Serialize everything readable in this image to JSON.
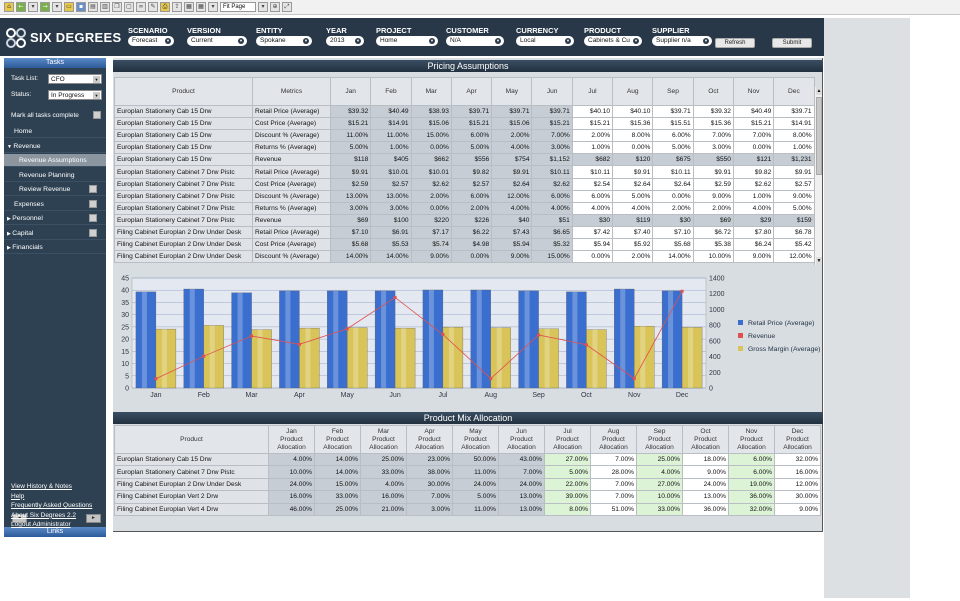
{
  "toolbar": {
    "page_fit": "Fit Page"
  },
  "brand": "SIX DEGREES",
  "header": {
    "fields": [
      {
        "label": "SCENARIO",
        "value": "Forecast"
      },
      {
        "label": "VERSION",
        "value": "Current"
      },
      {
        "label": "ENTITY",
        "value": "Spokane"
      },
      {
        "label": "YEAR",
        "value": "2013"
      },
      {
        "label": "PROJECT",
        "value": "Home"
      },
      {
        "label": "CUSTOMER",
        "value": "N/A"
      },
      {
        "label": "CURRENCY",
        "value": "Local"
      },
      {
        "label": "PRODUCT",
        "value": "Cabinets & Cu"
      },
      {
        "label": "SUPPLIER",
        "value": "Supplier n/a"
      }
    ],
    "refresh_label": "Refresh",
    "submit_label": "Submit"
  },
  "sidebar": {
    "tasks_title": "Tasks",
    "task_list_label": "Task List:",
    "task_list_value": "CFO",
    "status_label": "Status:",
    "status_value": "In Progress",
    "mark_complete_label": "Mark all tasks complete",
    "nav": [
      {
        "label": "Home",
        "indent": 0,
        "expander": "",
        "check": false
      },
      {
        "label": "Revenue",
        "indent": 0,
        "expander": "▼",
        "check": false
      },
      {
        "label": "Revenue Assumptions",
        "indent": 2,
        "expander": "",
        "check": false,
        "active": true
      },
      {
        "label": "Revenue Planning",
        "indent": 2,
        "expander": "",
        "check": false
      },
      {
        "label": "Review Revenue",
        "indent": 2,
        "expander": "",
        "check": true
      },
      {
        "label": "Expenses",
        "indent": 0,
        "expander": "",
        "check": true
      },
      {
        "label": "Personnel",
        "indent": 0,
        "expander": "▶",
        "check": true
      },
      {
        "label": "Capital",
        "indent": 0,
        "expander": "▶",
        "check": true
      },
      {
        "label": "Financials",
        "indent": 0,
        "expander": "▶",
        "check": false
      }
    ],
    "links_title": "Links",
    "links": [
      "View History & Notes",
      "Help",
      "Frequently Asked Questions",
      "About Six Degrees 2.2",
      "Logout Administrator"
    ]
  },
  "pricing": {
    "title": "Pricing Assumptions",
    "headers": [
      "Product",
      "Metrics",
      "Jan",
      "Feb",
      "Mar",
      "Apr",
      "May",
      "Jun",
      "Jul",
      "Aug",
      "Sep",
      "Oct",
      "Nov",
      "Dec"
    ],
    "rows": [
      {
        "product": "Europlan Stationery Cab 15 Drw",
        "metric": "Retail Price (Average)",
        "values": [
          "$39.32",
          "$40.49",
          "$38.93",
          "$39.71",
          "$39.71",
          "$39.71",
          "$40.10",
          "$40.10",
          "$39.71",
          "$39.32",
          "$40.49",
          "$39.71"
        ],
        "band": false
      },
      {
        "product": "Europlan Stationery Cab 15 Drw",
        "metric": "Cost Price (Average)",
        "values": [
          "$15.21",
          "$14.91",
          "$15.06",
          "$15.21",
          "$15.06",
          "$15.21",
          "$15.21",
          "$15.36",
          "$15.51",
          "$15.36",
          "$15.21",
          "$14.91"
        ],
        "band": false
      },
      {
        "product": "Europlan Stationery Cab 15 Drw",
        "metric": "Discount % (Average)",
        "values": [
          "11.00%",
          "11.00%",
          "15.00%",
          "6.00%",
          "2.00%",
          "7.00%",
          "2.00%",
          "8.00%",
          "6.00%",
          "7.00%",
          "7.00%",
          "8.00%"
        ],
        "band": false
      },
      {
        "product": "Europlan Stationery Cab 15 Drw",
        "metric": "Returns % (Average)",
        "values": [
          "5.00%",
          "1.00%",
          "0.00%",
          "5.00%",
          "4.00%",
          "3.00%",
          "1.00%",
          "0.00%",
          "5.00%",
          "3.00%",
          "0.00%",
          "1.00%"
        ],
        "band": false
      },
      {
        "product": "Europlan Stationery Cab 15 Drw",
        "metric": "Revenue",
        "values": [
          "$118",
          "$405",
          "$662",
          "$556",
          "$754",
          "$1,152",
          "$682",
          "$120",
          "$675",
          "$550",
          "$121",
          "$1,231"
        ],
        "band": true
      },
      {
        "product": "Europlan Stationery Cabinet 7 Drw Pistc",
        "metric": "Retail Price (Average)",
        "values": [
          "$9.91",
          "$10.01",
          "$10.01",
          "$9.82",
          "$9.91",
          "$10.11",
          "$10.11",
          "$9.91",
          "$10.11",
          "$9.91",
          "$9.82",
          "$9.91"
        ],
        "band": false
      },
      {
        "product": "Europlan Stationery Cabinet 7 Drw Pistc",
        "metric": "Cost Price (Average)",
        "values": [
          "$2.59",
          "$2.57",
          "$2.62",
          "$2.57",
          "$2.64",
          "$2.62",
          "$2.54",
          "$2.64",
          "$2.64",
          "$2.59",
          "$2.62",
          "$2.57"
        ],
        "band": false
      },
      {
        "product": "Europlan Stationery Cabinet 7 Drw Pistc",
        "metric": "Discount % (Average)",
        "values": [
          "13.00%",
          "13.00%",
          "2.00%",
          "6.00%",
          "12.00%",
          "6.00%",
          "6.00%",
          "5.00%",
          "0.00%",
          "9.00%",
          "1.00%",
          "9.00%"
        ],
        "band": false
      },
      {
        "product": "Europlan Stationery Cabinet 7 Drw Pistc",
        "metric": "Returns % (Average)",
        "values": [
          "3.00%",
          "3.00%",
          "0.00%",
          "2.00%",
          "4.00%",
          "4.00%",
          "4.00%",
          "4.00%",
          "2.00%",
          "2.00%",
          "4.00%",
          "5.00%"
        ],
        "band": false
      },
      {
        "product": "Europlan Stationery Cabinet 7 Drw Pistc",
        "metric": "Revenue",
        "values": [
          "$69",
          "$100",
          "$220",
          "$226",
          "$40",
          "$51",
          "$30",
          "$119",
          "$30",
          "$69",
          "$29",
          "$159"
        ],
        "band": true
      },
      {
        "product": "Filing Cabinet Europlan 2 Drw Under Desk",
        "metric": "Retail Price (Average)",
        "values": [
          "$7.10",
          "$6.91",
          "$7.17",
          "$6.22",
          "$7.43",
          "$6.65",
          "$7.42",
          "$7.40",
          "$7.10",
          "$6.72",
          "$7.80",
          "$6.78"
        ],
        "band": false
      },
      {
        "product": "Filing Cabinet Europlan 2 Drw Under Desk",
        "metric": "Cost Price (Average)",
        "values": [
          "$5.68",
          "$5.53",
          "$5.74",
          "$4.98",
          "$5.94",
          "$5.32",
          "$5.94",
          "$5.92",
          "$5.68",
          "$5.38",
          "$6.24",
          "$5.42"
        ],
        "band": false
      },
      {
        "product": "Filing Cabinet Europlan 2 Drw Under Desk",
        "metric": "Discount % (Average)",
        "values": [
          "14.00%",
          "14.00%",
          "9.00%",
          "0.00%",
          "9.00%",
          "15.00%",
          "0.00%",
          "2.00%",
          "14.00%",
          "10.00%",
          "9.00%",
          "12.00%"
        ],
        "band": false
      }
    ]
  },
  "chart_data": {
    "type": "bar",
    "categories": [
      "Jan",
      "Feb",
      "Mar",
      "Apr",
      "May",
      "Jun",
      "Jul",
      "Aug",
      "Sep",
      "Oct",
      "Nov",
      "Dec"
    ],
    "series": [
      {
        "name": "Retail Price (Average)",
        "kind": "bar",
        "axis": "left",
        "color": "#3a6fd0",
        "values": [
          39.32,
          40.49,
          38.93,
          39.71,
          39.71,
          39.71,
          40.1,
          40.1,
          39.71,
          39.32,
          40.49,
          39.71
        ]
      },
      {
        "name": "Gross Margin (Average)",
        "kind": "bar",
        "axis": "left",
        "color": "#d8c458",
        "values": [
          24.1,
          25.6,
          23.9,
          24.5,
          24.7,
          24.5,
          24.9,
          24.7,
          24.2,
          23.9,
          25.3,
          24.8
        ]
      },
      {
        "name": "Revenue",
        "kind": "line",
        "axis": "right",
        "color": "#e05050",
        "values": [
          118,
          405,
          662,
          556,
          754,
          1152,
          682,
          120,
          675,
          550,
          121,
          1231
        ]
      }
    ],
    "legend": [
      "Retail Price (Average)",
      "Revenue",
      "Gross Margin (Average)"
    ],
    "left_ticks": [
      "0",
      "5",
      "10",
      "15",
      "20",
      "25",
      "30",
      "35",
      "40",
      "45"
    ],
    "right_ticks": [
      "0",
      "200",
      "400",
      "600",
      "800",
      "1000",
      "1200",
      "1400"
    ],
    "ylim_left": [
      0,
      45
    ],
    "ylim_right": [
      0,
      1400
    ],
    "legend_position": "right",
    "grid": true
  },
  "mix": {
    "title": "Product Mix Allocation",
    "headers": [
      "Product",
      "Jan Product Allocation",
      "Feb Product Allocation",
      "Mar Product Allocation",
      "Apr Product Allocation",
      "May Product Allocation",
      "Jun Product Allocation",
      "Jul Product Allocation",
      "Aug Product Allocation",
      "Sep Product Allocation",
      "Oct Product Allocation",
      "Nov Product Allocation",
      "Dec Product Allocation"
    ],
    "header_month": [
      "Jan",
      "Feb",
      "Mar",
      "Apr",
      "May",
      "Jun",
      "Jul",
      "Aug",
      "Sep",
      "Oct",
      "Nov",
      "Dec"
    ],
    "header_sub1": "Product",
    "header_sub2": "Allocation",
    "rows": [
      {
        "product": "Europlan Stationery Cab 15 Drw",
        "values": [
          "4.00%",
          "14.00%",
          "25.00%",
          "23.00%",
          "50.00%",
          "43.00%",
          "27.00%",
          "7.00%",
          "25.00%",
          "18.00%",
          "6.00%",
          "32.00%"
        ]
      },
      {
        "product": "Europlan Stationery Cabinet 7 Drw Pistc",
        "values": [
          "10.00%",
          "14.00%",
          "33.00%",
          "38.00%",
          "11.00%",
          "7.00%",
          "5.00%",
          "28.00%",
          "4.00%",
          "9.00%",
          "6.00%",
          "16.00%"
        ]
      },
      {
        "product": "Filing Cabinet Europlan 2 Drw Under Desk",
        "values": [
          "24.00%",
          "15.00%",
          "4.00%",
          "30.00%",
          "24.00%",
          "24.00%",
          "22.00%",
          "7.00%",
          "27.00%",
          "24.00%",
          "19.00%",
          "12.00%"
        ]
      },
      {
        "product": "Filing Cabinet Europlan Vert 2 Drw",
        "values": [
          "16.00%",
          "33.00%",
          "16.00%",
          "7.00%",
          "5.00%",
          "13.00%",
          "39.00%",
          "7.00%",
          "10.00%",
          "13.00%",
          "36.00%",
          "30.00%"
        ]
      },
      {
        "product": "Filing Cabinet Europlan Vert 4 Drw",
        "values": [
          "46.00%",
          "25.00%",
          "21.00%",
          "3.00%",
          "11.00%",
          "13.00%",
          "8.00%",
          "51.00%",
          "33.00%",
          "36.00%",
          "32.00%",
          "9.00%"
        ]
      }
    ]
  }
}
